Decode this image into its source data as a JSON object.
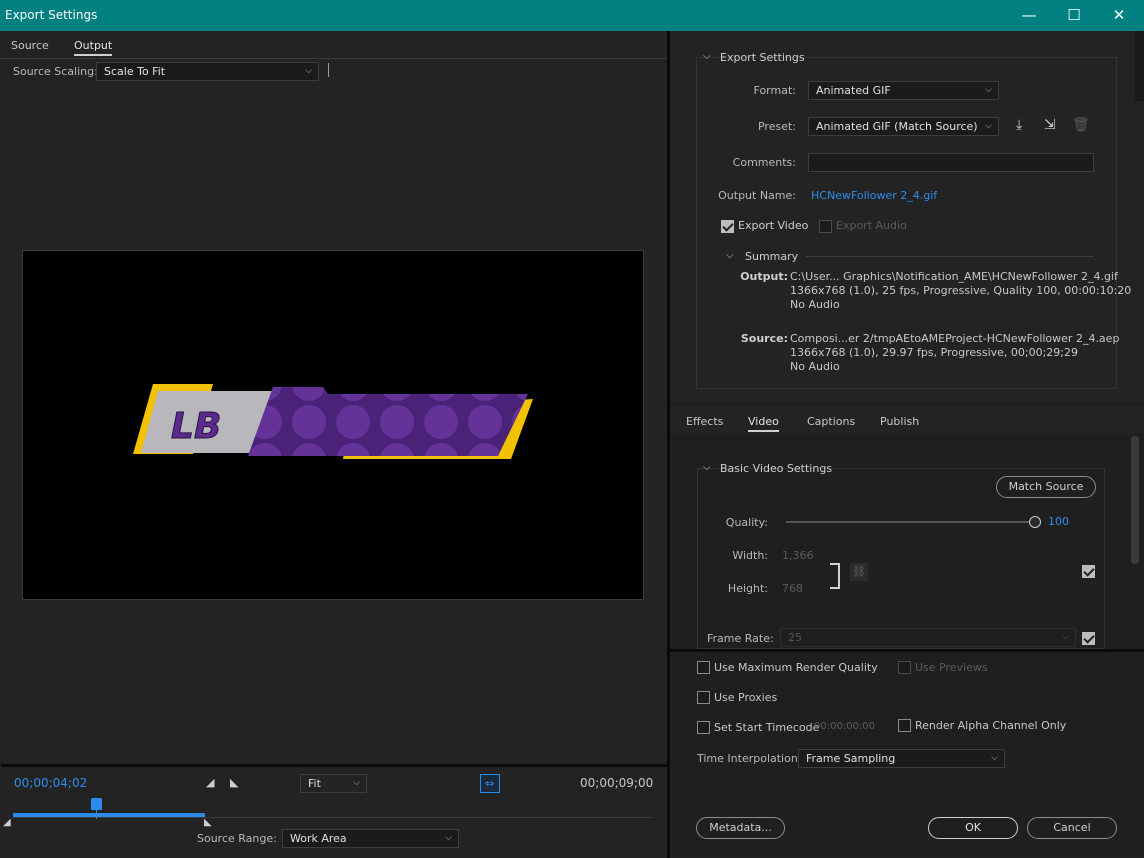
{
  "window": {
    "title": "Export Settings",
    "minimize": "—",
    "maximize": "☐",
    "close": "✕"
  },
  "left": {
    "tabs": [
      "Source",
      "Output"
    ],
    "source_scaling_label": "Source Scaling:",
    "source_scaling_value": "Scale To Fit",
    "preview_logo_text": "LB",
    "current_time": "00;00;04;02",
    "zoom_value": "Fit",
    "end_time": "00;00;09;00",
    "source_range_label": "Source Range:",
    "source_range_value": "Work Area",
    "playhead_fraction": 0.43
  },
  "export_settings": {
    "section_title": "Export Settings",
    "format_label": "Format:",
    "format_value": "Animated GIF",
    "preset_label": "Preset:",
    "preset_value": "Animated GIF (Match Source)",
    "comments_label": "Comments:",
    "comments_value": "",
    "output_name_label": "Output Name:",
    "output_name_value": "HCNewFollower 2_4.gif",
    "export_video_label": "Export Video",
    "export_audio_label": "Export Audio",
    "export_video_checked": true,
    "export_audio_checked": false
  },
  "summary": {
    "title": "Summary",
    "output_label": "Output:",
    "output_lines": [
      "C:\\User... Graphics\\Notification_AME\\HCNewFollower 2_4.gif",
      "1366x768 (1.0), 25 fps, Progressive, Quality 100, 00:00:10:20",
      "No Audio"
    ],
    "source_label": "Source:",
    "source_lines": [
      "Composi...er 2/tmpAEtoAMEProject-HCNewFollower 2_4.aep",
      "1366x768 (1.0), 29.97 fps, Progressive, 00;00;29;29",
      "No Audio"
    ]
  },
  "tabs2": [
    "Effects",
    "Video",
    "Captions",
    "Publish"
  ],
  "basic_video": {
    "title": "Basic Video Settings",
    "match_source": "Match Source",
    "quality_label": "Quality:",
    "quality_value": "100",
    "quality_fraction": 1.0,
    "width_label": "Width:",
    "width_value": "1,366",
    "height_label": "Height:",
    "height_value": "768",
    "frame_rate_label": "Frame Rate:",
    "frame_rate_value": "25"
  },
  "options": {
    "max_render_quality": "Use Maximum Render Quality",
    "use_previews": "Use Previews",
    "use_proxies": "Use Proxies",
    "set_start_timecode": "Set Start Timecode",
    "start_timecode_value": "00:00:00:00",
    "render_alpha": "Render Alpha Channel Only",
    "time_interpolation_label": "Time Interpolation:",
    "time_interpolation_value": "Frame Sampling"
  },
  "footer": {
    "metadata": "Metadata...",
    "ok": "OK",
    "cancel": "Cancel"
  },
  "colors": {
    "titlebar": "#008080",
    "accent_blue": "#2d8ceb",
    "logo_purple": "#5b2a8c",
    "logo_gold": "#f2c200"
  }
}
